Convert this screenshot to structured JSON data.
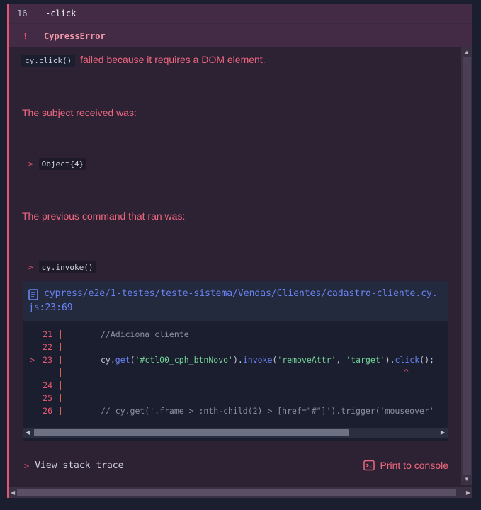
{
  "command": {
    "number": "16",
    "name": "-click"
  },
  "error": {
    "bang": "!",
    "name": "CypressError",
    "message_code": "cy.click()",
    "message_text": "failed because it requires a DOM element.",
    "subject_label": "The subject received was:",
    "subject_arrow": ">",
    "subject_value": "Object{4}",
    "previous_label": "The previous command that ran was:",
    "previous_arrow": ">",
    "previous_value": "cy.invoke()"
  },
  "code_frame": {
    "file_path": "cypress/e2e/1-testes/teste-sistema/Vendas/Clientes/cadastro-cliente.cy.js:23:69",
    "lines": [
      {
        "num": "21",
        "code": "//Adiciona cliente"
      },
      {
        "num": "22",
        "code": ""
      },
      {
        "num": "23",
        "current": true,
        "arrow": ">"
      },
      {
        "num": "",
        "caret": "^"
      },
      {
        "num": "24",
        "code": ""
      },
      {
        "num": "25",
        "code": ""
      },
      {
        "num": "26",
        "code": "// cy.get('.frame > :nth-child(2) > [href=\"#\"]').trigger('mouseover'"
      }
    ],
    "line23": {
      "p1": "cy.",
      "fn1": "get",
      "p2": "(",
      "s1": "'#ctl00_cph_btnNovo'",
      "p3": ").",
      "fn2": "invoke",
      "p4": "(",
      "s2": "'removeAttr'",
      "p5": ", ",
      "s3": "'target'",
      "p6": ").",
      "fn3": "click",
      "p7": "();"
    }
  },
  "actions": {
    "stack_chevron": ">",
    "view_stack_trace": "View stack trace",
    "print_to_console": "Print to console"
  },
  "colors": {
    "accent": "#e45770",
    "link": "#6b84f5",
    "string": "#74d397",
    "background": "#2d2134"
  },
  "icons": [
    "file-icon",
    "console-icon",
    "chevron-right-icon"
  ]
}
